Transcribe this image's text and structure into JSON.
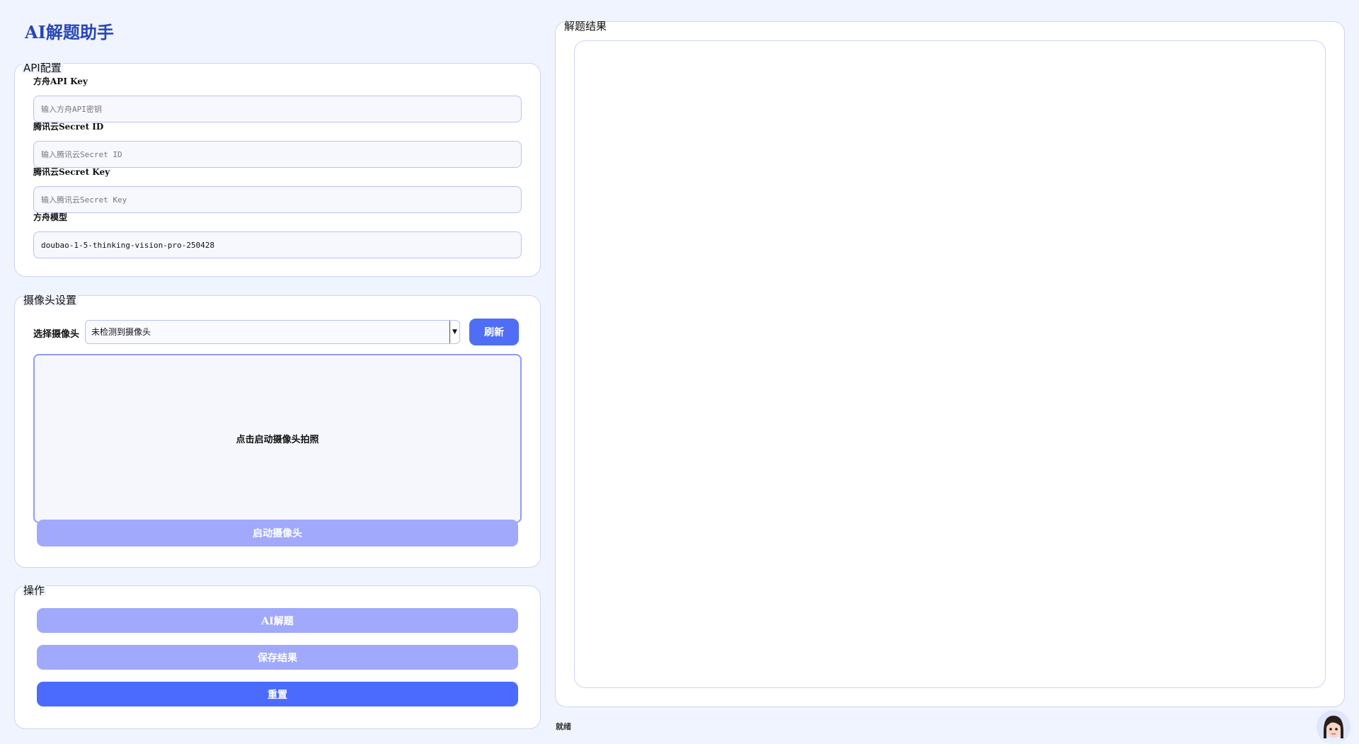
{
  "app": {
    "title": "AI解题助手"
  },
  "api_config": {
    "title": "API配置",
    "fields": [
      {
        "label": "方舟API Key",
        "value": "",
        "placeholder": "输入方舟API密钥"
      },
      {
        "label": "腾讯云Secret ID",
        "value": "",
        "placeholder": "输入腾讯云Secret ID"
      },
      {
        "label": "腾讯云Secret Key",
        "value": "",
        "placeholder": "输入腾讯云Secret Key"
      },
      {
        "label": "方舟模型",
        "value": "doubao-1-5-thinking-vision-pro-250428",
        "placeholder": ""
      }
    ]
  },
  "camera": {
    "title": "摄像头设置",
    "select_label": "选择摄像头",
    "select_value": "未检测到摄像头",
    "refresh_label": "刷新",
    "preview_text": "点击启动摄像头拍照",
    "start_label": "启动摄像头"
  },
  "actions": {
    "title": "操作",
    "solve_label": "AI解题",
    "save_label": "保存结果",
    "reset_label": "重置"
  },
  "results": {
    "title": "解题结果",
    "content": ""
  },
  "status": {
    "text": "就绪"
  },
  "colors": {
    "accent": "#4a6bfd",
    "accent_disabled": "#a0a9fb",
    "title": "#2747b8",
    "background": "#f0f4fe"
  }
}
